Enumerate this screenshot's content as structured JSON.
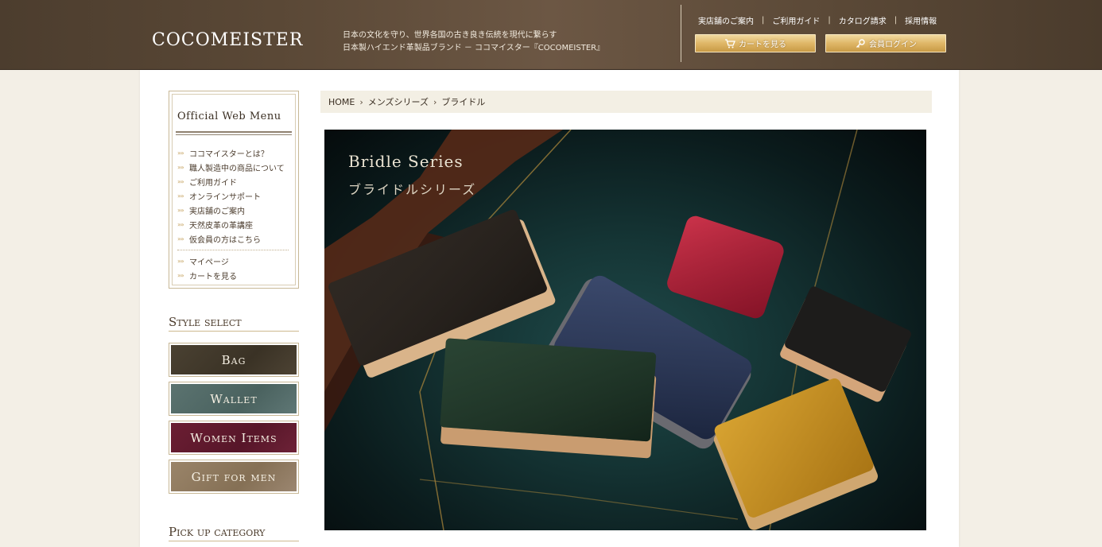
{
  "header": {
    "logo": "COCOMEISTER",
    "tagline_line1": "日本の文化を守り、世界各国の古き良き伝統を現代に繋らす",
    "tagline_line2": "日本製ハイエンド革製品ブランド － ココマイスター『COCOMEISTER』",
    "top_links": [
      "実店舗のご案内",
      "ご利用ガイド",
      "カタログ請求",
      "採用情報"
    ],
    "top_link_separator": "|",
    "cart_button": "カートを見る",
    "login_button": "会員ログイン",
    "cart_icon": "cart-icon",
    "login_icon": "key-icon"
  },
  "side_menu": {
    "title": "Official Web Menu",
    "bullet": "»»",
    "items": [
      "ココマイスターとは？",
      "職人製造中の商品について",
      "ご利用ガイド",
      "オンラインサポート",
      "実店舗のご案内",
      "天然皮革の革講座",
      "仮会員の方はこちら"
    ],
    "account_items": [
      "マイページ",
      "カートを見る"
    ]
  },
  "style_select": {
    "heading": "Style select",
    "buttons": [
      "Bag",
      "Wallet",
      "Women Items",
      "Gift for men"
    ]
  },
  "pickup": {
    "heading": "Pick up category"
  },
  "breadcrumb": {
    "items": [
      "HOME",
      "メンズシリーズ",
      "ブライドル"
    ],
    "separator": "›"
  },
  "hero": {
    "title": "Bridle Series",
    "subtitle": "ブライドルシリーズ"
  },
  "colors": {
    "header_bg": "#5a4836",
    "page_bg": "#f3efe6",
    "button_gold": "#dfb768",
    "bag": "#3f3629",
    "wallet": "#52696a",
    "women": "#5e1a2c",
    "gift": "#8f7a5f"
  }
}
